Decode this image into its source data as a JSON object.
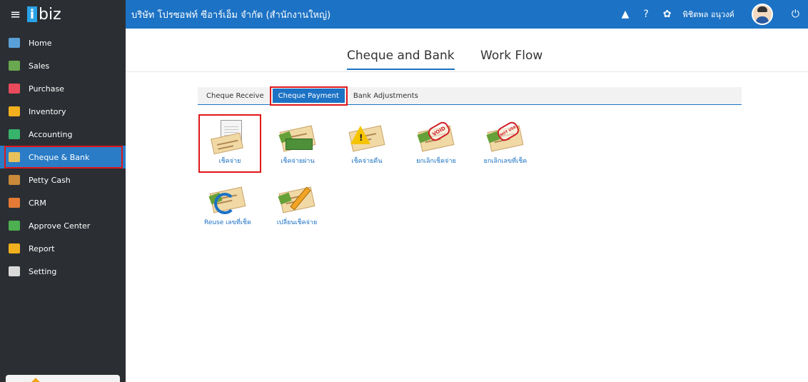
{
  "app": {
    "logo_text": "biz",
    "logo_i": "i"
  },
  "sidebar": {
    "items": [
      {
        "label": "Home",
        "icon": "home-icon",
        "color": "#5aa0d8"
      },
      {
        "label": "Sales",
        "icon": "sales-icon",
        "color": "#6aa84f"
      },
      {
        "label": "Purchase",
        "icon": "cart-icon",
        "color": "#e94b5c"
      },
      {
        "label": "Inventory",
        "icon": "box-icon",
        "color": "#f2b01e"
      },
      {
        "label": "Accounting",
        "icon": "ledger-icon",
        "color": "#38b36b"
      },
      {
        "label": "Cheque & Bank",
        "icon": "bank-icon",
        "color": "#e8c15a"
      },
      {
        "label": "Petty Cash",
        "icon": "wallet-icon",
        "color": "#c98a3a"
      },
      {
        "label": "CRM",
        "icon": "people-icon",
        "color": "#e47a35"
      },
      {
        "label": "Approve Center",
        "icon": "check-circle-icon",
        "color": "#4caf50"
      },
      {
        "label": "Report",
        "icon": "report-icon",
        "color": "#f2b01e"
      },
      {
        "label": "Setting",
        "icon": "tools-icon",
        "color": "#d9d9d9"
      }
    ],
    "active_index": 5
  },
  "topbar": {
    "company": "บริษัท โปรซอฟท์ ซีอาร์เอ็ม จำกัด (สำนักงานใหญ่)",
    "bell": "▲",
    "help": "?",
    "gear": "✿",
    "username": "พิชิตพล อนุวงค์",
    "power": "⏻"
  },
  "main_tabs": [
    {
      "label": "Cheque and Bank",
      "active": true
    },
    {
      "label": "Work Flow",
      "active": false
    }
  ],
  "sub_tabs": [
    {
      "label": "Cheque Receive",
      "selected": false
    },
    {
      "label": "Cheque Payment",
      "selected": true
    },
    {
      "label": "Bank Adjustments",
      "selected": false
    }
  ],
  "tiles": [
    {
      "label": "เช็คจ่าย",
      "icon": "cheque-document-icon"
    },
    {
      "label": "เช็คจ่ายผ่าน",
      "icon": "cheque-cash-icon"
    },
    {
      "label": "เช็คจ่ายคืน",
      "icon": "cheque-warning-icon"
    },
    {
      "label": "ยกเลิกเช็คจ่าย",
      "icon": "cheque-void-icon",
      "stamp": "VOID"
    },
    {
      "label": "ยกเลิกเลขที่เช็ค",
      "icon": "cheque-notuse-icon",
      "stamp": "NOT USE"
    },
    {
      "label": "Reuse เลขที่เช็ค",
      "icon": "cheque-reuse-icon"
    },
    {
      "label": "เปลี่ยนเช็คจ่าย",
      "icon": "cheque-edit-icon"
    }
  ]
}
